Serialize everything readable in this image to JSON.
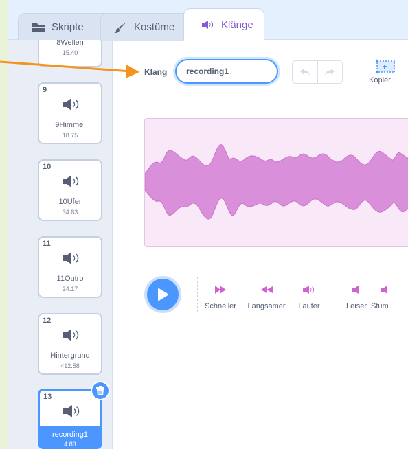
{
  "tabs": [
    {
      "label": "Skripte",
      "icon": "code-icon"
    },
    {
      "label": "Kostüme",
      "icon": "brush-icon"
    },
    {
      "label": "Klänge",
      "icon": "speaker-icon",
      "active": true
    }
  ],
  "sounds": [
    {
      "number": "",
      "name": "8Wellen",
      "duration": "15.40",
      "partial": true
    },
    {
      "number": "9",
      "name": "9Himmel",
      "duration": "18.75"
    },
    {
      "number": "10",
      "name": "10Ufer",
      "duration": "34.83"
    },
    {
      "number": "11",
      "name": "11Outro",
      "duration": "24.17"
    },
    {
      "number": "12",
      "name": "Hintergrund",
      "duration": "412.58"
    },
    {
      "number": "13",
      "name": "recording1",
      "duration": "4.83",
      "selected": true
    }
  ],
  "editor": {
    "name_label": "Klang",
    "name_value": "recording1",
    "copy_label": "Kopier"
  },
  "effects": [
    {
      "label": "Schneller",
      "icon": "faster-icon"
    },
    {
      "label": "Langsamer",
      "icon": "slower-icon"
    },
    {
      "label": "Lauter",
      "icon": "louder-icon"
    },
    {
      "label": "Leiser",
      "icon": "softer-icon"
    },
    {
      "label": "Stum",
      "icon": "mute-icon"
    }
  ],
  "colors": {
    "accent_blue": "#4c97ff",
    "effect_magenta": "#cf63cf",
    "waveform_fill": "#d98fd9",
    "waveform_bg": "#f8e8f8",
    "annotation_orange": "#f5931f"
  }
}
